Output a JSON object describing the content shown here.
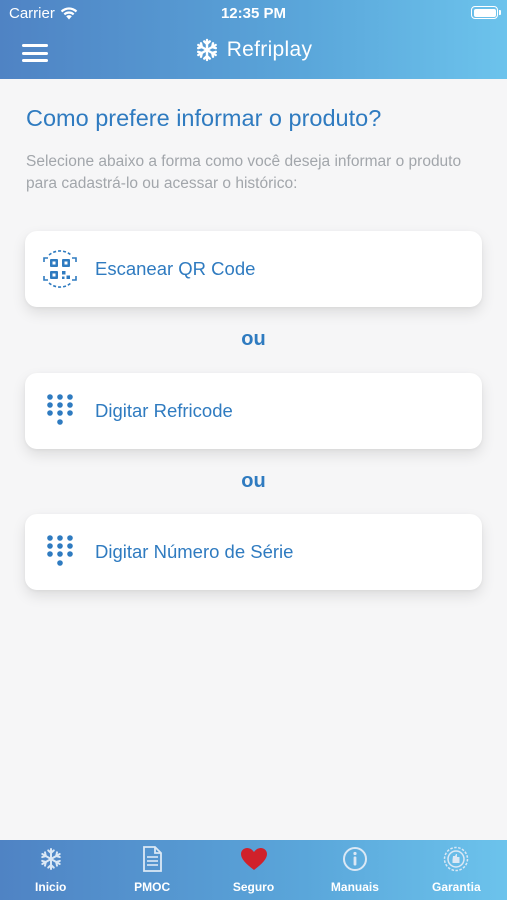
{
  "status": {
    "carrier": "Carrier",
    "time": "12:35 PM"
  },
  "app": {
    "name": "Refriplay"
  },
  "main": {
    "heading": "Como prefere informar o produto?",
    "subtitle": "Selecione abaixo a forma como você deseja informar o produto para cadastrá-lo ou acessar o histórico:",
    "separator": "ou",
    "options": [
      {
        "label": "Escanear QR Code",
        "icon": "qr-scan-icon"
      },
      {
        "label": "Digitar Refricode",
        "icon": "keypad-icon"
      },
      {
        "label": "Digitar Número de Série",
        "icon": "keypad-icon"
      }
    ]
  },
  "tabs": [
    {
      "label": "Inicio",
      "icon": "snowflake-icon"
    },
    {
      "label": "PMOC",
      "icon": "document-icon"
    },
    {
      "label": "Seguro",
      "icon": "heart-icon"
    },
    {
      "label": "Manuais",
      "icon": "info-icon"
    },
    {
      "label": "Garantia",
      "icon": "seal-icon"
    }
  ],
  "colors": {
    "primary": "#2f7bc0",
    "header_start": "#4f83c4",
    "header_end": "#6cc3ec",
    "heart": "#d0212b",
    "tab_icon": "#dbe8f5"
  }
}
